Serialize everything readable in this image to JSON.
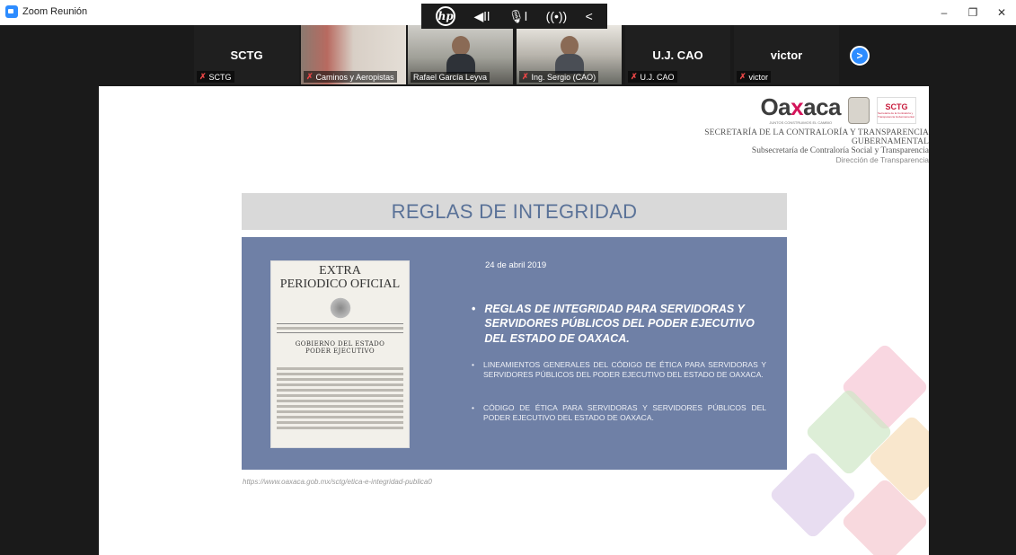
{
  "window": {
    "title": "Zoom Reunión",
    "controls": {
      "minimize": "–",
      "restore": "❐",
      "close": "✕"
    }
  },
  "hp_toolbar": {
    "logo": "hp",
    "icons": [
      "speaker-icon",
      "mic-icon",
      "broadcast-icon",
      "chevron-left-icon"
    ],
    "glyphs": {
      "speaker": "◀ǀǀ",
      "mic": "🎙ǀ",
      "broadcast": "((•))",
      "collapse": "<"
    }
  },
  "participants": [
    {
      "name_display": "SCTG",
      "label": "SCTG",
      "muted": true,
      "video": false
    },
    {
      "name_display": "",
      "label": "Caminos y Aeropistas",
      "muted": true,
      "video": true
    },
    {
      "name_display": "",
      "label": "Rafael García Leyva",
      "muted": false,
      "video": true
    },
    {
      "name_display": "",
      "label": "Ing. Sergio (CAO)",
      "muted": true,
      "video": true
    },
    {
      "name_display": "U.J. CAO",
      "label": "U.J. CAO",
      "muted": true,
      "video": false
    },
    {
      "name_display": "victor",
      "label": "victor",
      "muted": true,
      "video": false
    }
  ],
  "next_page": ">",
  "slide": {
    "logo_main": {
      "pre": "Oa",
      "x": "x",
      "post": "aca",
      "tagline": "JUNTOS CONSTRUIMOS EL CAMBIO"
    },
    "logo_sctg": {
      "title": "SCTG",
      "sub": "Secretaría de la Contraloría y Transparencia Gubernamental"
    },
    "org_line_1": "SECRETARÍA DE LA CONTRALORÍA Y TRANSPARENCIA GUBERNAMENTAL",
    "org_line_2": "Subsecretaría de Contraloría Social y Transparencia",
    "org_line_3": "Dirección de Transparencia",
    "title": "REGLAS DE INTEGRIDAD",
    "newspaper": {
      "title_1": "EXTRA",
      "title_2": "PERIODICO OFICIAL",
      "gov_1": "GOBIERNO DEL ESTADO",
      "gov_2": "PODER EJECUTIVO"
    },
    "date": "24 de abril 2019",
    "bullet_main": "REGLAS DE INTEGRIDAD PARA SERVIDORAS Y SERVIDORES PÚBLICOS DEL PODER EJECUTIVO DEL ESTADO DE OAXACA.",
    "bullet_sub_1": "LINEAMIENTOS GENERALES DEL CÓDIGO DE ÉTICA PARA SERVIDORAS Y SERVIDORES PÚBLICOS DEL PODER EJECUTIVO DEL ESTADO DE OAXACA.",
    "bullet_sub_2": "CÓDIGO DE ÉTICA PARA SERVIDORAS Y SERVIDORES PÚBLICOS DEL PODER EJECUTIVO DEL ESTADO DE OAXACA.",
    "bullet_marker": "•",
    "url": "https://www.oaxaca.gob.mx/sctg/etica-e-integridad-publica0"
  },
  "colors": {
    "zoom_blue": "#2d8cff",
    "panel": "#6f80a6",
    "title_text": "#5a7298",
    "muted_red": "#e64545"
  }
}
